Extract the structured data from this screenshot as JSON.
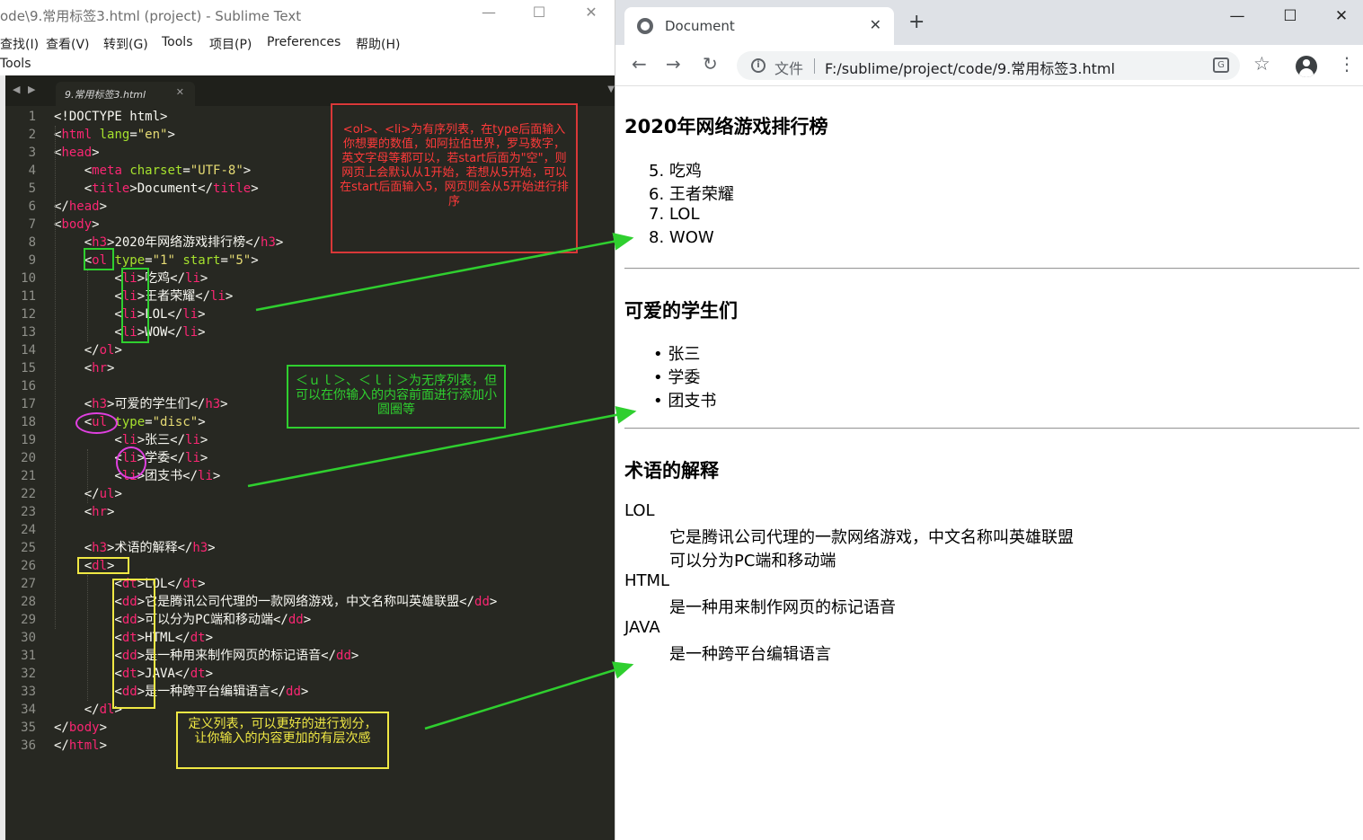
{
  "sublime": {
    "title": "ode\\9.常用标签3.html (project) - Sublime Text",
    "menu": [
      "查找(I)",
      "查看(V)",
      "转到(G)",
      "Tools",
      "项目(P)",
      "Preferences",
      "帮助(H)"
    ],
    "toolbar_item": "Tools",
    "tab_label": "9.常用标签3.html",
    "code_lines": [
      "<!DOCTYPE html>",
      "<html lang=\"en\">",
      "<head>",
      "    <meta charset=\"UTF-8\">",
      "    <title>Document</title>",
      "</head>",
      "<body>",
      "    <h3>2020年网络游戏排行榜</h3>",
      "    <ol type=\"1\" start=\"5\">",
      "        <li>吃鸡</li>",
      "        <li>王者荣耀</li>",
      "        <li>LOL</li>",
      "        <li>WOW</li>",
      "    </ol>",
      "    <hr>",
      "",
      "    <h3>可爱的学生们</h3>",
      "    <ul type=\"disc\">",
      "        <li>张三</li>",
      "        <li>学委</li>",
      "        <li>团支书</li>",
      "    </ul>",
      "    <hr>",
      "",
      "    <h3>术语的解释</h3>",
      "    <dl>",
      "        <dt>LOL</dt>",
      "        <dd>它是腾讯公司代理的一款网络游戏，中文名称叫英雄联盟</dd>",
      "        <dd>可以分为PC端和移动端</dd>",
      "        <dt>HTML</dt>",
      "        <dd>是一种用来制作网页的标记语音</dd>",
      "        <dt>JAVA</dt>",
      "        <dd>是一种跨平台编辑语言</dd>",
      "    </dl>",
      "</body>",
      "</html>"
    ],
    "annotations": {
      "ol": "<ol>、<li>为有序列表，在type后面输入你想要的数值，如阿拉伯世界，罗马数字，英文字母等都可以，若start后面为\"空\"，则网页上会默认从1开始，若想从5开始，可以在start后面输入5，网页则会从5开始进行排序",
      "ul": "＜ｕｌ＞、＜ｌｉ＞为无序列表，但可以在你输入的内容前面进行添加小圆圈等",
      "dl": "定义列表，可以更好的进行划分，让你输入的内容更加的有层次感"
    }
  },
  "chrome": {
    "tab_title": "Document",
    "file_label": "文件",
    "url": "F:/sublime/project/code/9.常用标签3.html",
    "translate_glyph": "G"
  },
  "page": {
    "section1": {
      "heading": "2020年网络游戏排行榜",
      "start": 5,
      "items": [
        "吃鸡",
        "王者荣耀",
        "LOL",
        "WOW"
      ]
    },
    "section2": {
      "heading": "可爱的学生们",
      "items": [
        "张三",
        "学委",
        "团支书"
      ]
    },
    "section3": {
      "heading": "术语的解释",
      "terms": [
        {
          "dt": "LOL",
          "dd": [
            "它是腾讯公司代理的一款网络游戏，中文名称叫英雄联盟",
            "可以分为PC端和移动端"
          ]
        },
        {
          "dt": "HTML",
          "dd": [
            "是一种用来制作网页的标记语音"
          ]
        },
        {
          "dt": "JAVA",
          "dd": [
            "是一种跨平台编辑语言"
          ]
        }
      ]
    }
  },
  "colors": {
    "editor_bg": "#272822",
    "tag": "#f92672",
    "attr": "#a6e22e",
    "string": "#e6db74",
    "annotation_red": "#d93838",
    "annotation_green": "#2fcf2f",
    "annotation_yellow": "#f0e844",
    "annotation_magenta": "#e040e0"
  }
}
